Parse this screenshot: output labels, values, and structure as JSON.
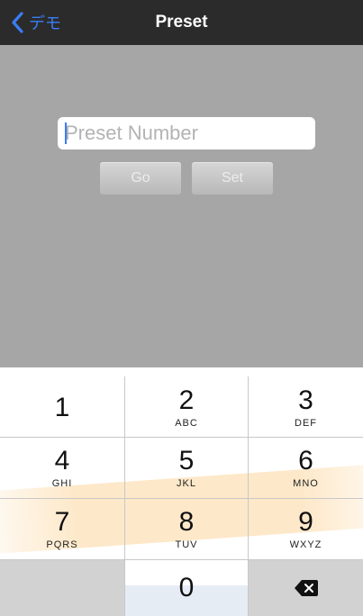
{
  "navbar": {
    "back_label": "デモ",
    "title": "Preset"
  },
  "preset": {
    "placeholder": "Preset Number",
    "go_label": "Go",
    "set_label": "Set"
  },
  "keypad": {
    "keys": [
      {
        "digit": "1",
        "letters": ""
      },
      {
        "digit": "2",
        "letters": "ABC"
      },
      {
        "digit": "3",
        "letters": "DEF"
      },
      {
        "digit": "4",
        "letters": "GHI"
      },
      {
        "digit": "5",
        "letters": "JKL"
      },
      {
        "digit": "6",
        "letters": "MNO"
      },
      {
        "digit": "7",
        "letters": "PQRS"
      },
      {
        "digit": "8",
        "letters": "TUV"
      },
      {
        "digit": "9",
        "letters": "WXYZ"
      },
      {
        "digit": "0",
        "letters": ""
      }
    ],
    "delete_icon": "backspace-icon"
  },
  "colors": {
    "navbar_bg": "#2b2b2b",
    "accent": "#3a7df5",
    "content_bg": "#a6a6a6",
    "button_text": "#ececec"
  }
}
